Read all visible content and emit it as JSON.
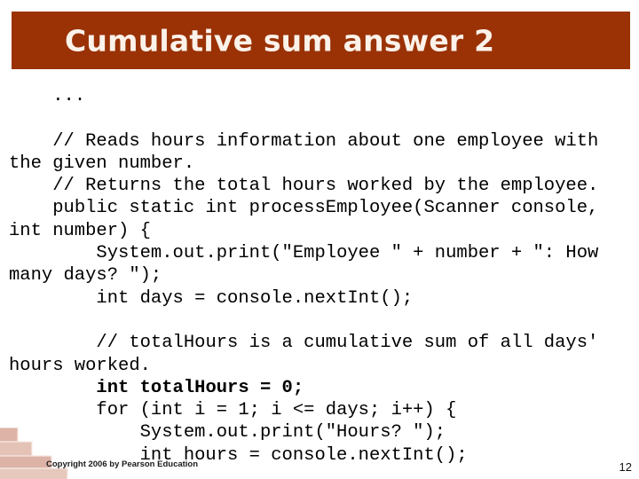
{
  "slide": {
    "title": "Cumulative sum answer 2",
    "title_bar_color": "#9A3206",
    "title_text_color": "#FBF2EA",
    "background_color": "#ffffff",
    "page_number": "12",
    "copyright": "Copyright 2006 by Pearson Education"
  },
  "code": {
    "line_1": "    ...",
    "line_2": "",
    "line_3": "    // Reads hours information about one employee with the given number.",
    "line_4": "    // Returns the total hours worked by the employee.",
    "line_5": "    public static int processEmployee(Scanner console, int number) {",
    "line_6": "        System.out.print(\"Employee \" + number + \": How many days? \");",
    "line_7": "        int days = console.nextInt();",
    "line_8": "",
    "line_9": "        // totalHours is a cumulative sum of all days' hours worked.",
    "line_10": "        int totalHours = 0;",
    "line_11": "        for (int i = 1; i <= days; i++) {",
    "line_12": "            System.out.print(\"Hours? \");",
    "line_13": "            int hours = console.nextInt();"
  }
}
